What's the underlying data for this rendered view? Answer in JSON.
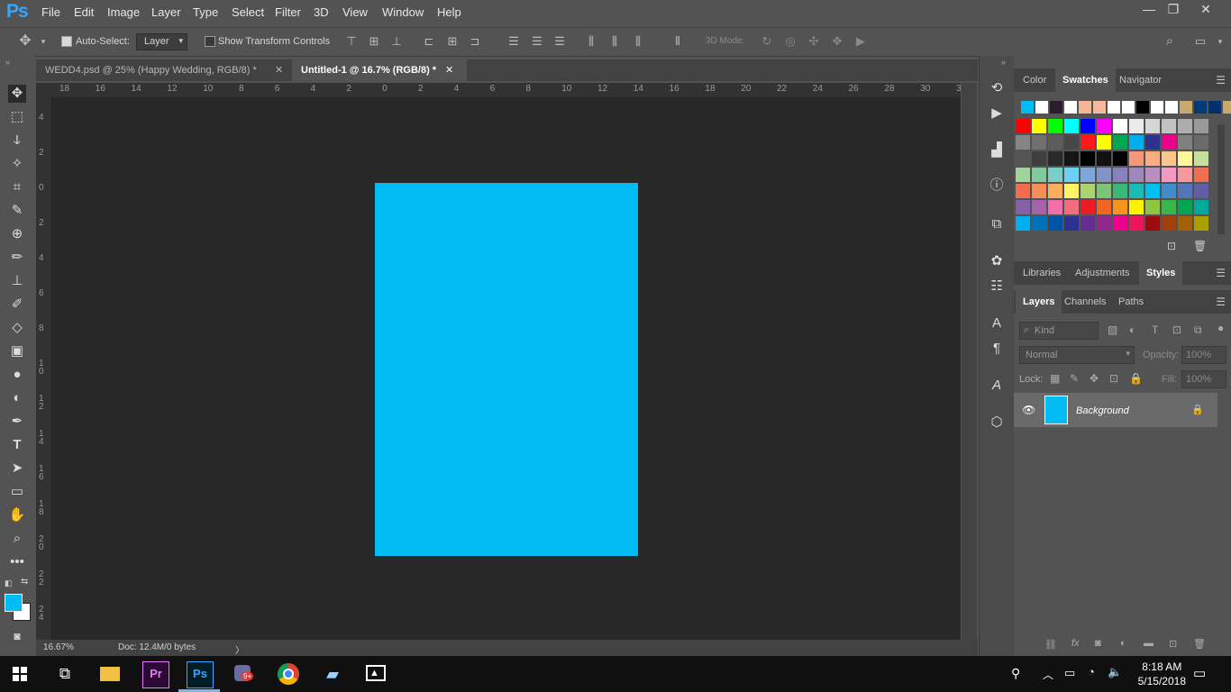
{
  "app": {
    "logo": "Ps"
  },
  "menu": [
    "File",
    "Edit",
    "Image",
    "Layer",
    "Type",
    "Select",
    "Filter",
    "3D",
    "View",
    "Window",
    "Help"
  ],
  "window_controls": {
    "minimize": "—",
    "restore": "❐",
    "close": "✕"
  },
  "options": {
    "auto_select_label": "Auto-Select:",
    "auto_select_value": "Layer",
    "show_transform_label": "Show Transform Controls",
    "mode_3d_label": "3D Mode:"
  },
  "tabs": [
    {
      "label": "WEDD4.psd @ 25% (Happy  Wedding, RGB/8) *",
      "close": "✕"
    },
    {
      "label": "Untitled-1 @ 16.7% (RGB/8) *",
      "close": "✕"
    }
  ],
  "ruler_top": [
    "18",
    "16",
    "14",
    "12",
    "10",
    "8",
    "6",
    "4",
    "2",
    "0",
    "2",
    "4",
    "6",
    "8",
    "10",
    "12",
    "14",
    "16",
    "18",
    "20",
    "22",
    "24",
    "26",
    "28",
    "30",
    "32"
  ],
  "ruler_left": [
    "4",
    "2",
    "0",
    "2",
    "4",
    "6",
    "8",
    "10",
    "12",
    "14",
    "16",
    "18",
    "20",
    "22",
    "24"
  ],
  "document": {
    "fill_color": "#00bcf2"
  },
  "status": {
    "zoom": "16.67%",
    "doc_info": "Doc: 12.4M/0 bytes",
    "arrow": "〉"
  },
  "panels": {
    "top_tabs": [
      "Color",
      "Swatches",
      "Navigator"
    ],
    "mid_tabs": [
      "Libraries",
      "Adjustments",
      "Styles"
    ],
    "layer_tabs": [
      "Layers",
      "Channels",
      "Paths"
    ],
    "filter_placeholder": "Kind",
    "blend_mode": "Normal",
    "opacity_label": "Opacity:",
    "opacity_value": "100%",
    "lock_label": "Lock:",
    "fill_label": "Fill:",
    "fill_value": "100%",
    "layer_name": "Background"
  },
  "swatch_rows": [
    [
      "#00bcf2",
      "#ffffff",
      "#2d1b2e",
      "#ffffff",
      "#f7b596",
      "#f5b99b",
      "#ffffff",
      "#ffffff",
      "#000000",
      "#ffffff",
      "#ffffff",
      "#c8a96b",
      "#003a78",
      "#00306e",
      "#c8a96b"
    ],
    [
      "#ff0000",
      "#ffff00",
      "#00ff00",
      "#00ffff",
      "#0000ff",
      "#ff00ff",
      "#ffffff",
      "#ebebeb",
      "#d6d6d6",
      "#c2c2c2",
      "#adadad",
      "#999999"
    ],
    [
      "#858585",
      "#707070",
      "#5c5c5c",
      "#474747",
      "#ff1a1a",
      "#ffff00",
      "#00a651",
      "#00aeef",
      "#2e3192",
      "#ec008c",
      "#808080",
      "#6a6a6a"
    ],
    [
      "#555555",
      "#3f3f3f",
      "#2a2a2a",
      "#151515",
      "#000000",
      "#111111",
      "#000000",
      "#f7977a",
      "#f9ad81",
      "#fdc68a",
      "#fff79a",
      "#c4df9b"
    ],
    [
      "#a3d39c",
      "#82ca9d",
      "#7bcdc8",
      "#6dcff6",
      "#7da7d9",
      "#8393ca",
      "#8781bd",
      "#a187be",
      "#bc8dbf",
      "#f49ac2",
      "#f6989d",
      "#ef6f4f"
    ],
    [
      "#f26c4f",
      "#f68e56",
      "#fbaf5c",
      "#fff467",
      "#acd372",
      "#7cc576",
      "#3bb878",
      "#1abbb4",
      "#00bff3",
      "#438ccb",
      "#5574b9",
      "#605ca8"
    ],
    [
      "#855fa8",
      "#a763a8",
      "#f06ea9",
      "#f26d7d",
      "#ed1c24",
      "#f26522",
      "#f7941d",
      "#fff200",
      "#8dc73f",
      "#39b54a",
      "#00a651",
      "#00a99d"
    ],
    [
      "#00aeef",
      "#0072bc",
      "#0054a6",
      "#2e3192",
      "#662d91",
      "#92278f",
      "#ec008c",
      "#ed145b",
      "#9e0b0f",
      "#a0410d",
      "#a36209",
      "#aba000"
    ]
  ],
  "taskbar": {
    "time": "8:18 AM",
    "date": "5/15/2018",
    "badge": "9+"
  }
}
